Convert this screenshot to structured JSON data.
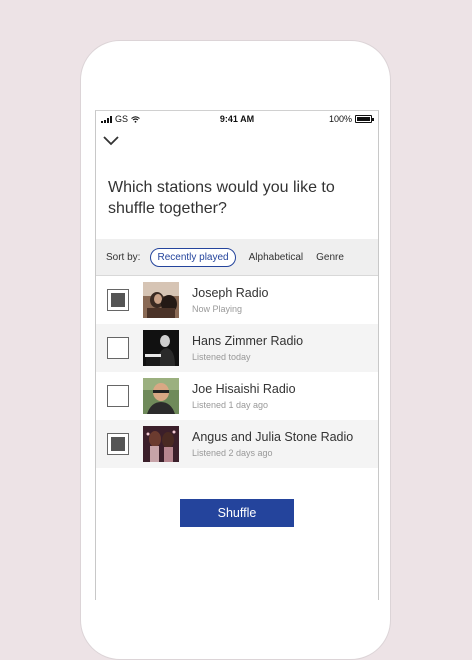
{
  "status_bar": {
    "carrier": "GS",
    "time": "9:41 AM",
    "battery": "100%",
    "icons": [
      "signal-icon",
      "wifi-icon",
      "battery-icon"
    ]
  },
  "header": {
    "back_icon": "chevron-down-icon",
    "question": "Which stations would you like to shuffle together?"
  },
  "sort": {
    "label": "Sort by:",
    "options": [
      {
        "label": "Recently played",
        "selected": true
      },
      {
        "label": "Alphabetical",
        "selected": false
      },
      {
        "label": "Genre",
        "selected": false
      }
    ]
  },
  "stations": [
    {
      "name": "Joseph Radio",
      "status": "Now Playing",
      "checked": true
    },
    {
      "name": "Hans Zimmer Radio",
      "status": "Listened today",
      "checked": false
    },
    {
      "name": "Joe Hisaishi Radio",
      "status": "Listened 1 day ago",
      "checked": false
    },
    {
      "name": "Angus and Julia Stone Radio",
      "status": "Listened 2 days ago",
      "checked": true
    }
  ],
  "action": {
    "shuffle_label": "Shuffle"
  },
  "colors": {
    "accent": "#24449c",
    "background": "#ede3e6",
    "alt_row": "#f4f4f4"
  }
}
